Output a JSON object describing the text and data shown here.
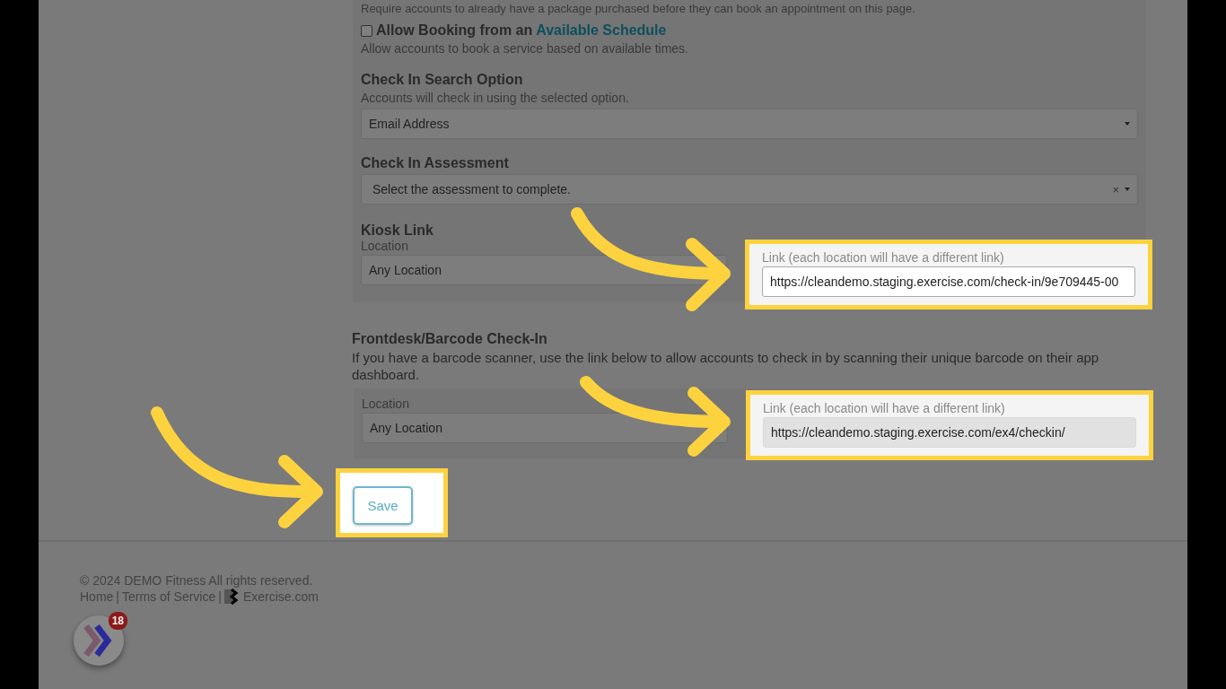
{
  "top_note": "Require accounts to already have a package purchased before they can book an appointment on this page.",
  "booking_option": {
    "checked": false,
    "label": "Allow Booking from an",
    "link": "Available Schedule",
    "hint": "Allow accounts to book a service based on available times."
  },
  "search_option": {
    "title": "Check In Search Option",
    "hint": "Accounts will check in using the selected option.",
    "value": "Email Address"
  },
  "assessment": {
    "title": "Check In Assessment",
    "placeholder": "Select the assessment to complete.",
    "clear": "×"
  },
  "kiosk": {
    "title": "Kiosk Link",
    "location_label": "Location",
    "location_value": "Any Location",
    "link_label": "Link (each location will have a different link)",
    "link_value": "https://cleandemo.staging.exercise.com/check-in/9e709445-00",
    "readonly": false
  },
  "frontdesk": {
    "title": "Frontdesk/Barcode Check-In",
    "description": "If you have a barcode scanner, use the link below to allow accounts to check in by scanning their unique barcode on their app dashboard.",
    "location_label": "Location",
    "location_value": "Any Location",
    "link_label": "Link (each location will have a different link)",
    "link_value": "https://cleandemo.staging.exercise.com/ex4/checkin/",
    "readonly": true
  },
  "save_button": "Save",
  "footer": {
    "copyright": "© 2024 DEMO Fitness All rights reserved.",
    "links": [
      "Home",
      "Terms of Service"
    ],
    "separator": "|",
    "brand": "Exercise.com"
  },
  "chat": {
    "badge": "18"
  }
}
